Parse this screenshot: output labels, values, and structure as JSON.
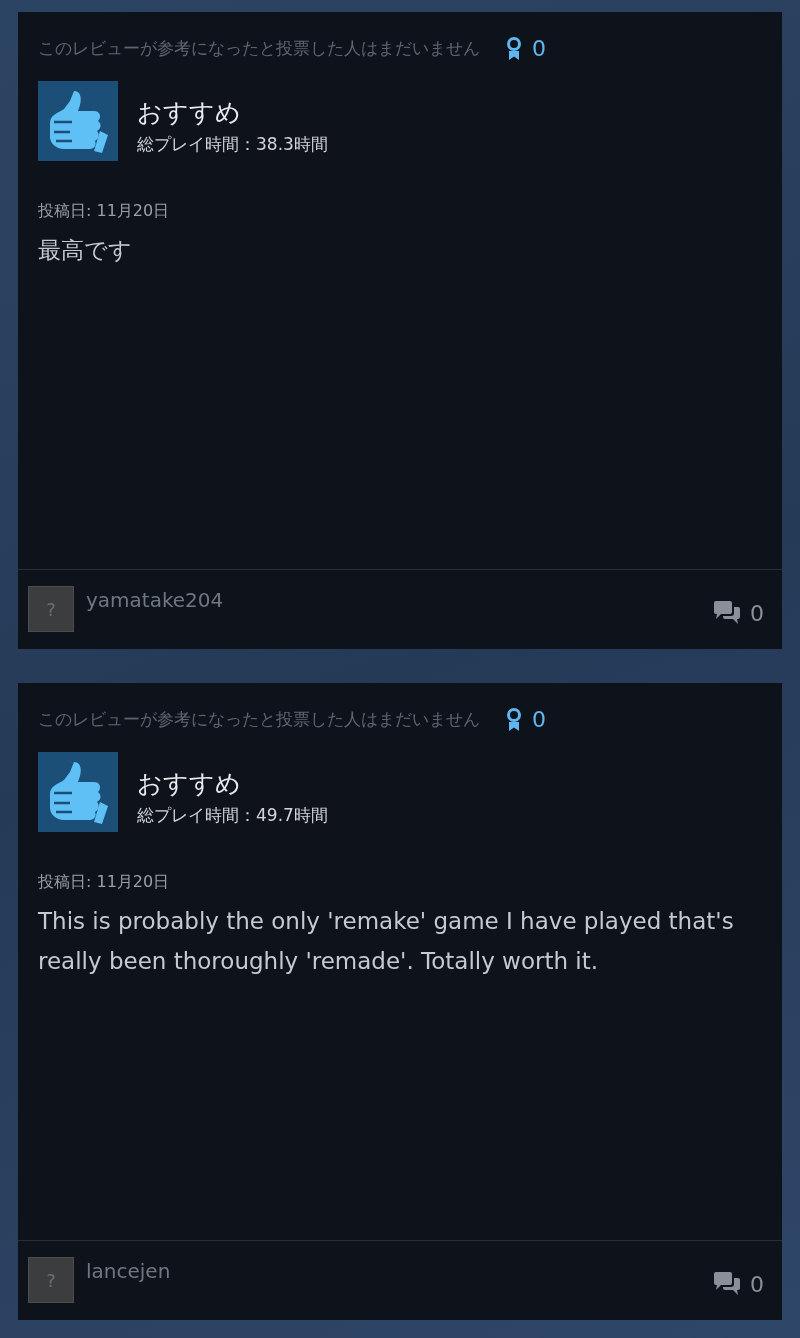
{
  "reviews": [
    {
      "helpful_text": "このレビューが参考になったと投票した人はまだいません",
      "award_count": "0",
      "verdict": "おすすめ",
      "recommended": true,
      "playtime": "総プレイ時間：38.3時間",
      "posted": "投稿日: 11月20日",
      "body": "最高です",
      "avatar_glyph": "?",
      "author": "yamatake204",
      "comment_count": "0"
    },
    {
      "helpful_text": "このレビューが参考になったと投票した人はまだいません",
      "award_count": "0",
      "verdict": "おすすめ",
      "recommended": true,
      "playtime": "総プレイ時間：49.7時間",
      "posted": "投稿日: 11月20日",
      "body": "This is probably the only 'remake' game I have played that's really been thoroughly 'remade'. Totally worth it.",
      "avatar_glyph": "?",
      "author": "lancejen",
      "comment_count": "0"
    }
  ]
}
